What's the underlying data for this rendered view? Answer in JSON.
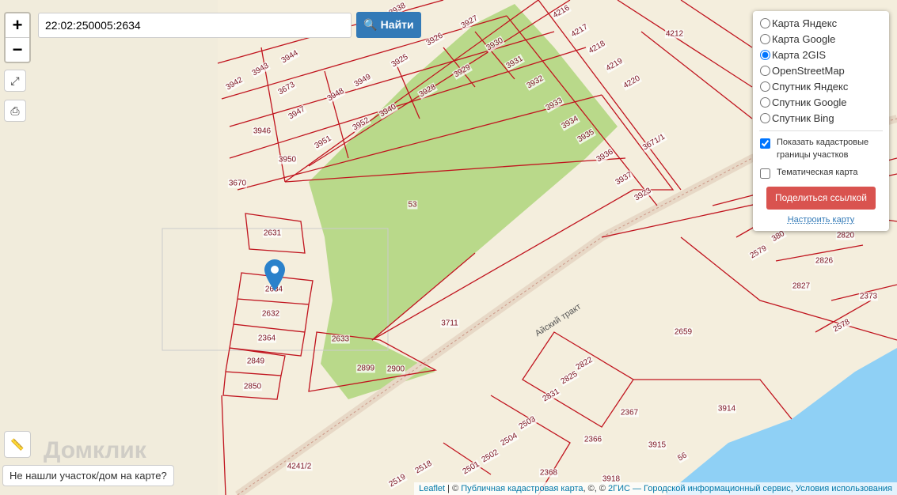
{
  "search": {
    "value": "22:02:250005:2634",
    "button": "Найти"
  },
  "zoom": {
    "in": "+",
    "out": "−"
  },
  "icons": {
    "fullscreen": "expand-icon",
    "print": "printer-icon",
    "ruler": "ruler-icon",
    "marker": "map-marker-icon"
  },
  "layers": {
    "options": [
      {
        "label": "Карта Яндекс",
        "checked": false
      },
      {
        "label": "Карта Google",
        "checked": false
      },
      {
        "label": "Карта 2GIS",
        "checked": true
      },
      {
        "label": "OpenStreetMap",
        "checked": false
      },
      {
        "label": "Спутник Яндекс",
        "checked": false
      },
      {
        "label": "Спутник Google",
        "checked": false
      },
      {
        "label": "Спутник Bing",
        "checked": false
      }
    ],
    "show_borders": "Показать кадастровые границы участков",
    "show_borders_checked": true,
    "thematic": "Тематическая карта",
    "thematic_checked": false,
    "share": "Поделиться ссылкой",
    "configure": "Настроить карту"
  },
  "not_found": "Не нашли участок/дом на карте?",
  "logo": "Домклик",
  "road": "Айский тракт",
  "attribution": {
    "leaflet": "Leaflet",
    "sep": " | © ",
    "pkk": "Публичная кадастровая карта",
    "mid": ", ©, © ",
    "gis": "2ГИС — Городской информационный сервис",
    "comma": ", ",
    "terms": "Условия использования"
  },
  "parcels": [
    "3938",
    "3927",
    "3926",
    "3930",
    "3944",
    "3925",
    "3929",
    "3931",
    "3942",
    "3943",
    "3673",
    "3949",
    "3928",
    "3932",
    "3948",
    "3940",
    "3933",
    "3947",
    "3952",
    "3934",
    "3946",
    "3951",
    "3935",
    "3950",
    "3936",
    "3670",
    "3937",
    "3923",
    "53",
    "4212",
    "4216",
    "4217",
    "4218",
    "4219",
    "4220",
    "3671/1",
    "2631",
    "2634",
    "2632",
    "2364",
    "2633",
    "2849",
    "2899",
    "2900",
    "2850",
    "3711",
    "2659",
    "2579",
    "2820",
    "2826",
    "2827",
    "2373",
    "2578",
    "2822",
    "2825",
    "2831",
    "2367",
    "2503",
    "2504",
    "2366",
    "2502",
    "2501",
    "3915",
    "3914",
    "2368",
    "3918",
    "2518",
    "2519",
    "4241/2",
    "56",
    "380"
  ],
  "colors": {
    "green": "#b9d98a",
    "water": "#8fd0f5",
    "border": "#c0141e"
  }
}
